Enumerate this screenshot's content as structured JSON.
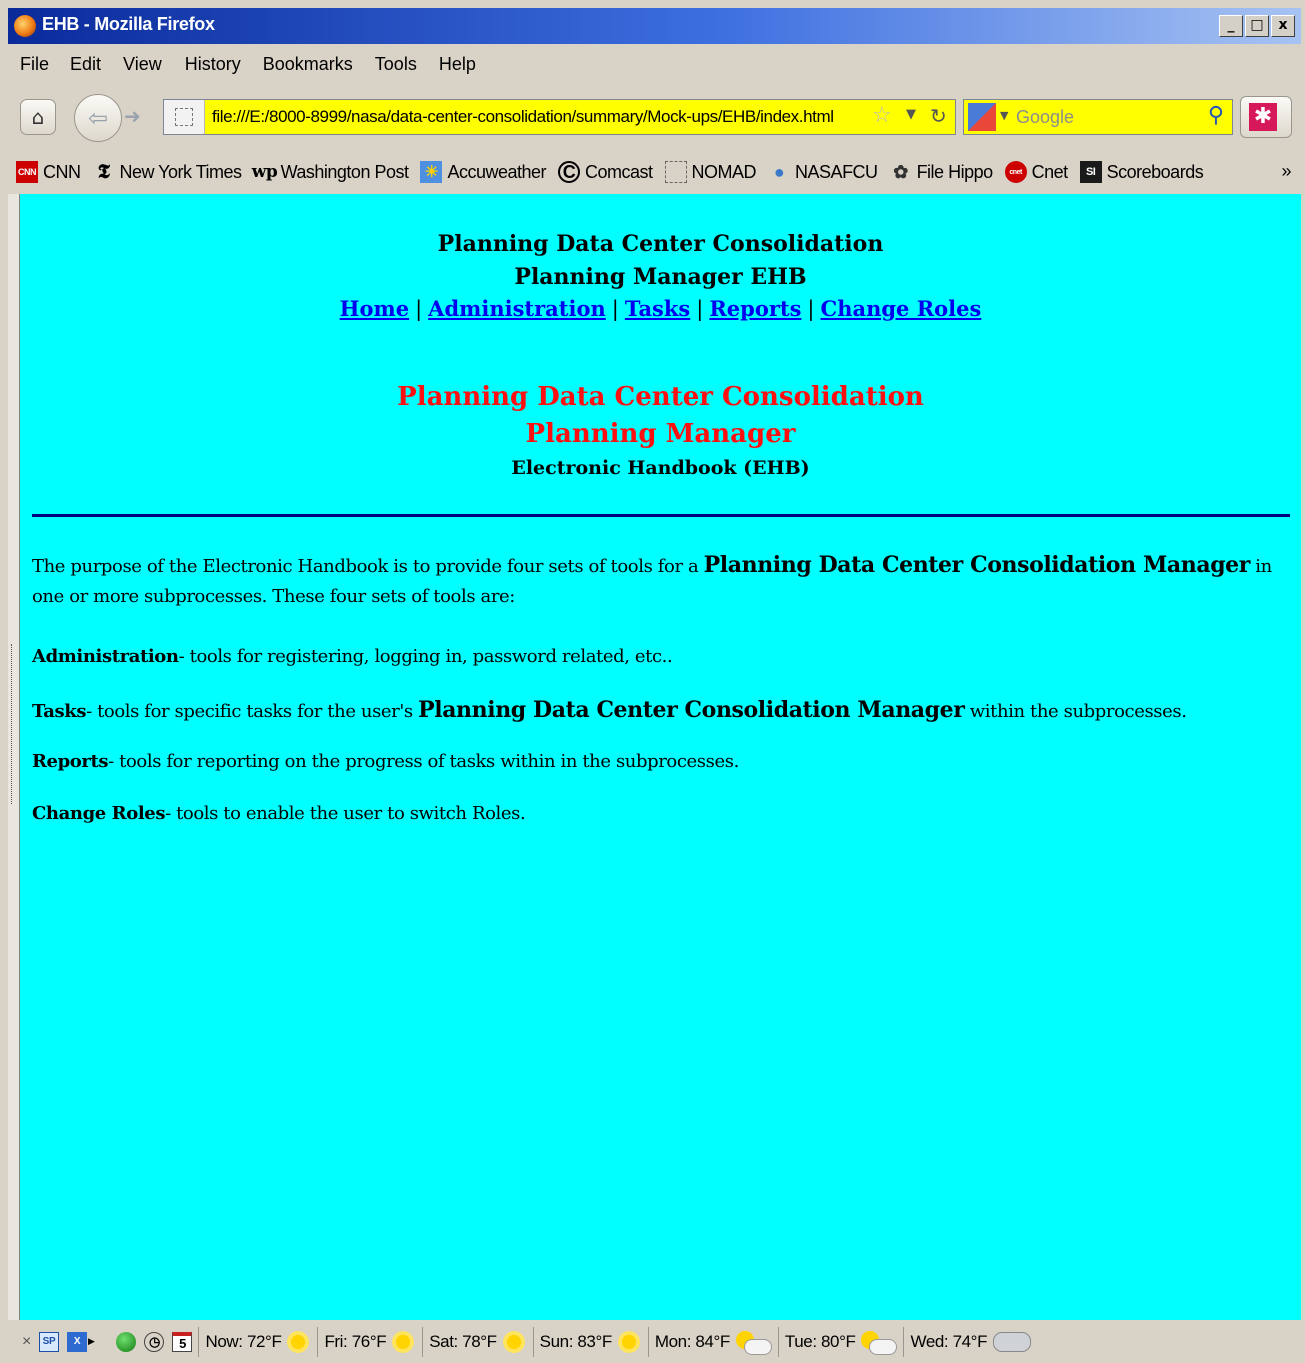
{
  "window": {
    "title": "EHB - Mozilla Firefox",
    "minimize": "_",
    "maximize": "□",
    "close": "x"
  },
  "menu": [
    "File",
    "Edit",
    "View",
    "History",
    "Bookmarks",
    "Tools",
    "Help"
  ],
  "toolbar": {
    "url": "file:///E:/8000-8999/nasa/data-center-consolidation/summary/Mock-ups/EHB/index.html",
    "search_placeholder": "Google"
  },
  "bookmarks": [
    {
      "label": "CNN",
      "icon": "cnn-icon",
      "color": "#cc0000",
      "glyph": "CNN"
    },
    {
      "label": "New York Times",
      "icon": "nyt-icon",
      "color": "#000000",
      "glyph": "𝕿"
    },
    {
      "label": "Washington Post",
      "icon": "wapo-icon",
      "color": "#000000",
      "glyph": "wp"
    },
    {
      "label": "Accuweather",
      "icon": "accuweather-icon",
      "color": "#f08a00",
      "glyph": "☀"
    },
    {
      "label": "Comcast",
      "icon": "comcast-icon",
      "color": "#000000",
      "glyph": "C"
    },
    {
      "label": "NOMAD",
      "icon": "nomad-icon",
      "color": "#888888",
      "glyph": ""
    },
    {
      "label": "NASAFCU",
      "icon": "nasafcu-icon",
      "color": "#3a78c9",
      "glyph": "●"
    },
    {
      "label": "File Hippo",
      "icon": "filehippo-icon",
      "color": "#333333",
      "glyph": "✿"
    },
    {
      "label": "Cnet",
      "icon": "cnet-icon",
      "color": "#cc0000",
      "glyph": "cnet"
    },
    {
      "label": "Scoreboards",
      "icon": "si-icon",
      "color": "#1a1a1a",
      "glyph": "SI"
    }
  ],
  "page": {
    "header_title": "Planning Data Center Consolidation",
    "header_subtitle": "Planning Manager EHB",
    "nav": [
      "Home",
      "Administration",
      "Tasks",
      "Reports",
      "Change Roles"
    ],
    "nav_sep": "|",
    "red_title": "Planning Data Center Consolidation",
    "red_subtitle": "Planning Manager",
    "ehb_label": "Electronic Handbook (EHB)",
    "intro_pre": "The purpose of the Electronic Handbook is to provide four sets of tools for a ",
    "intro_bold": "Planning Data Center Consolidation Manager",
    "intro_post": " in one or more subprocesses. These four sets of tools are:",
    "items": [
      {
        "term": "Administration",
        "pre": "- tools for registering, logging in, password related, etc..",
        "bold": "",
        "post": ""
      },
      {
        "term": "Tasks",
        "pre": "- tools for specific tasks for the user's ",
        "bold": "Planning Data Center Consolidation Manager",
        "post": " within the subprocesses."
      },
      {
        "term": "Reports",
        "pre": "- tools for reporting on the progress of tasks within in the subprocesses.",
        "bold": "",
        "post": ""
      },
      {
        "term": "Change Roles",
        "pre": "- tools to enable the user to switch Roles.",
        "bold": "",
        "post": ""
      }
    ]
  },
  "statusbar": {
    "close": "×",
    "calendar_day": "5",
    "weather": [
      {
        "label": "Now: 72°F",
        "icon": "sun"
      },
      {
        "label": "Fri: 76°F",
        "icon": "sun"
      },
      {
        "label": "Sat: 78°F",
        "icon": "sun"
      },
      {
        "label": "Sun: 83°F",
        "icon": "sun"
      },
      {
        "label": "Mon: 84°F",
        "icon": "cloudsun"
      },
      {
        "label": "Tue: 80°F",
        "icon": "cloudsun"
      },
      {
        "label": "Wed: 74°F",
        "icon": "cloud"
      }
    ]
  }
}
